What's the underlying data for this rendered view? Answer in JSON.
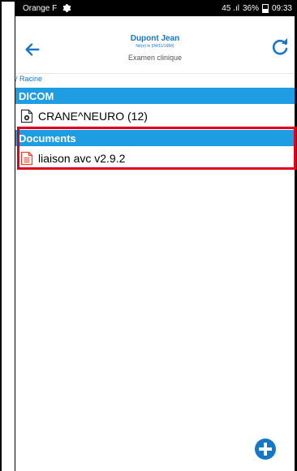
{
  "status_bar": {
    "carrier": "Orange F",
    "indicators": "45 .ıl",
    "battery_percent": "36%",
    "time": "09:33",
    "battery_icon": "battery-icon",
    "settings_icon": "gear-icon"
  },
  "header": {
    "back_icon": "arrow-left-icon",
    "refresh_icon": "refresh-icon",
    "patient_name": "Dupont Jean",
    "patient_dob": "Né(e) le (04/11/1984)",
    "exam_title": "Examen clinique"
  },
  "breadcrumb": "/ Racine",
  "sections": [
    {
      "title": "DICOM",
      "items": [
        {
          "label": "CRANE^NEURO (12)",
          "icon": "dicom-file-icon"
        }
      ]
    },
    {
      "title": "Documents",
      "items": [
        {
          "label": "liaison avc v2.9.2",
          "icon": "pdf-document-icon"
        }
      ]
    }
  ],
  "colors": {
    "accent": "#1677c7",
    "section_bg": "#1f9de3",
    "highlight": "#e0001b"
  },
  "fab": {
    "icon": "plus-icon"
  }
}
